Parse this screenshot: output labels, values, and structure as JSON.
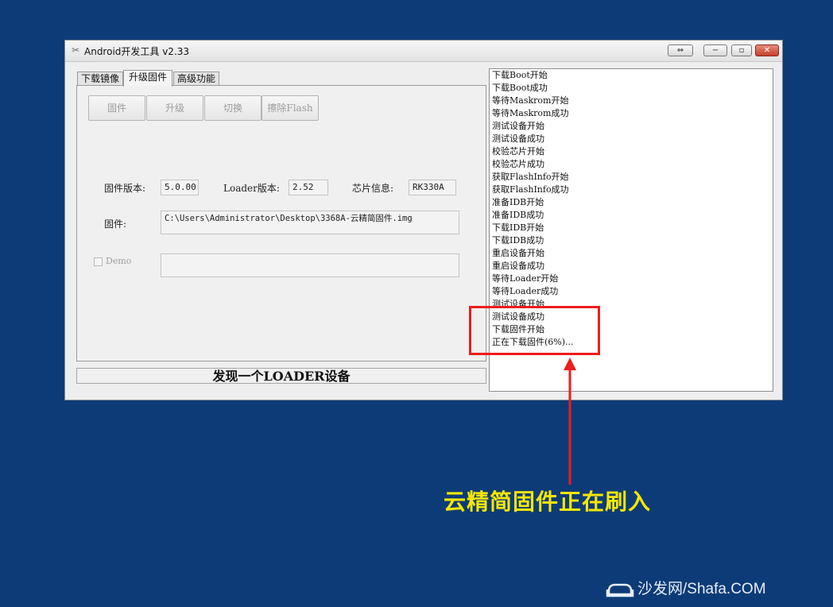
{
  "window": {
    "title": "Android开发工具 v2.33",
    "controls": {
      "restore_alt": "⇔",
      "minimize": "−",
      "maximize": "▫",
      "close": "✕"
    }
  },
  "tabs": [
    {
      "label": "下载镜像",
      "active": false
    },
    {
      "label": "升级固件",
      "active": true
    },
    {
      "label": "高级功能",
      "active": false
    }
  ],
  "buttons": {
    "firmware": "固件",
    "upgrade": "升级",
    "switch": "切换",
    "erase_flash": "擦除Flash"
  },
  "info": {
    "firmware_version_label": "固件版本:",
    "firmware_version": "5.0.00",
    "loader_version_label": "Loader版本:",
    "loader_version": "2.52",
    "chip_info_label": "芯片信息:",
    "chip_info": "RK330A",
    "firmware_label": "固件:",
    "firmware_path": "C:\\Users\\Administrator\\Desktop\\3368A-云精简固件.img",
    "demo_label": "Demo",
    "demo_value": ""
  },
  "status": {
    "text": "发现一个LOADER设备"
  },
  "log": [
    "下载Boot开始",
    "下载Boot成功",
    "等待Maskrom开始",
    "等待Maskrom成功",
    "测试设备开始",
    "测试设备成功",
    "校验芯片开始",
    "校验芯片成功",
    "获取FlashInfo开始",
    "获取FlashInfo成功",
    "准备IDB开始",
    "准备IDB成功",
    "下载IDB开始",
    "下载IDB成功",
    "重启设备开始",
    "重启设备成功",
    "等待Loader开始",
    "等待Loader成功",
    "测试设备开始",
    "测试设备成功",
    "下载固件开始",
    "正在下载固件(6%)..."
  ],
  "annotation": {
    "caption": "云精简固件正在刷入",
    "highlight_color": "#ee1c1c",
    "caption_color": "#f6e600"
  },
  "watermark": {
    "text": "沙发网/Shafa.COM"
  },
  "colors": {
    "background": "#0d3b78"
  }
}
